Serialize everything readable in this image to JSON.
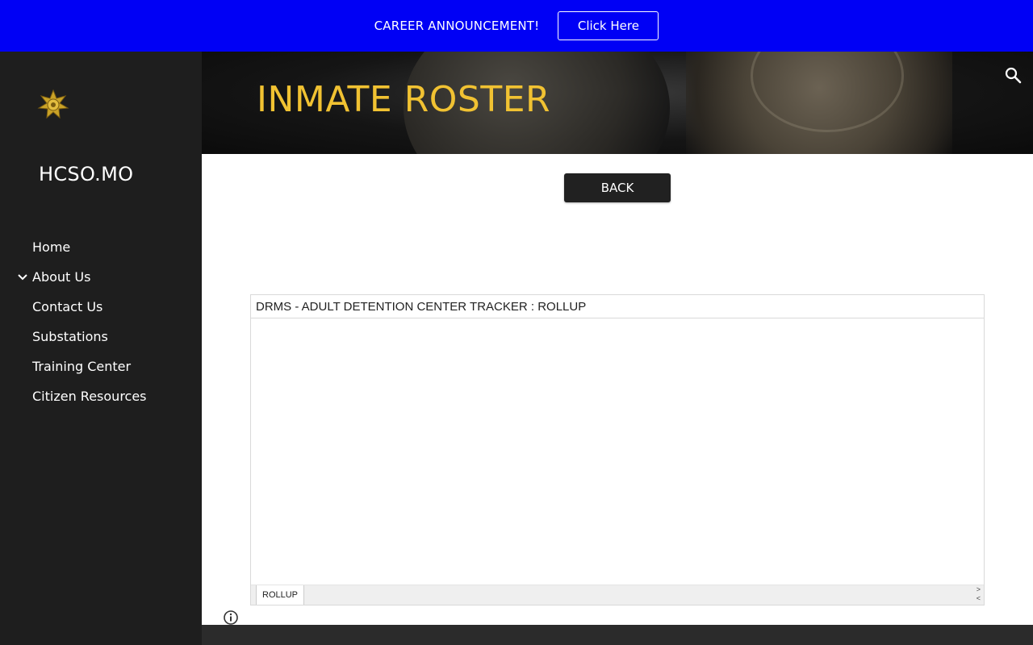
{
  "announcement": {
    "text": "CAREER ANNOUNCEMENT!",
    "button_label": "Click Here",
    "background_color": "#0000f5"
  },
  "sidebar": {
    "site_title": "HCSO.MO",
    "logo_icon": "sheriff-star-icon",
    "nav_items": [
      {
        "label": "Home"
      },
      {
        "label": "About Us",
        "expandable": true
      },
      {
        "label": "Contact Us"
      },
      {
        "label": "Substations"
      },
      {
        "label": "Training Center"
      },
      {
        "label": "Citizen Resources"
      }
    ]
  },
  "header": {
    "title": "INMATE ROSTER",
    "title_color": "#f1c232",
    "search_icon": "search-icon"
  },
  "main": {
    "back_button_label": "BACK",
    "sheet": {
      "title": "DRMS - ADULT DETENTION CENTER TRACKER : ROLLUP",
      "tab_label": "ROLLUP",
      "scroll_right": ">",
      "scroll_left": "<"
    }
  },
  "footer": {
    "info_icon": "info-icon"
  }
}
